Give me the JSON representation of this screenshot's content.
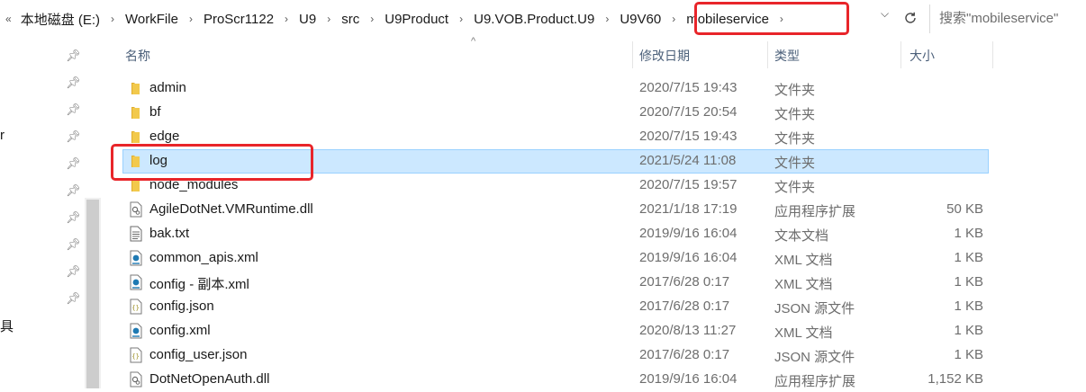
{
  "address": {
    "lead": "«",
    "separator": "›",
    "crumbs": [
      "本地磁盘 (E:)",
      "WorkFile",
      "ProScr1122",
      "U9",
      "src",
      "U9Product",
      "U9.VOB.Product.U9",
      "U9V60",
      "mobileservice"
    ],
    "dropdown_icon": "chevron-down-icon",
    "refresh_icon": "refresh-icon"
  },
  "search": {
    "placeholder": "搜索\"mobileservice\""
  },
  "navpane": {
    "fragments": [
      "r",
      "具"
    ],
    "pin_icon": "pin-icon"
  },
  "columns": {
    "name": "名称",
    "modified": "修改日期",
    "type": "类型",
    "size": "大小"
  },
  "files": [
    {
      "name": "admin",
      "modified": "2020/7/15 19:43",
      "type": "文件夹",
      "size": "",
      "icon": "folder-icon"
    },
    {
      "name": "bf",
      "modified": "2020/7/15 20:54",
      "type": "文件夹",
      "size": "",
      "icon": "folder-icon"
    },
    {
      "name": "edge",
      "modified": "2020/7/15 19:43",
      "type": "文件夹",
      "size": "",
      "icon": "folder-icon"
    },
    {
      "name": "log",
      "modified": "2021/5/24 11:08",
      "type": "文件夹",
      "size": "",
      "icon": "folder-icon",
      "selected": true
    },
    {
      "name": "node_modules",
      "modified": "2020/7/15 19:57",
      "type": "文件夹",
      "size": "",
      "icon": "folder-icon"
    },
    {
      "name": "AgileDotNet.VMRuntime.dll",
      "modified": "2021/1/18 17:19",
      "type": "应用程序扩展",
      "size": "50 KB",
      "icon": "dll-file-icon"
    },
    {
      "name": "bak.txt",
      "modified": "2019/9/16 16:04",
      "type": "文本文档",
      "size": "1 KB",
      "icon": "text-file-icon"
    },
    {
      "name": "common_apis.xml",
      "modified": "2019/9/16 16:04",
      "type": "XML 文档",
      "size": "1 KB",
      "icon": "xml-file-icon"
    },
    {
      "name": "config - 副本.xml",
      "modified": "2017/6/28 0:17",
      "type": "XML 文档",
      "size": "1 KB",
      "icon": "xml-file-icon"
    },
    {
      "name": "config.json",
      "modified": "2017/6/28 0:17",
      "type": "JSON 源文件",
      "size": "1 KB",
      "icon": "json-file-icon"
    },
    {
      "name": "config.xml",
      "modified": "2020/8/13 11:27",
      "type": "XML 文档",
      "size": "1 KB",
      "icon": "xml-file-icon"
    },
    {
      "name": "config_user.json",
      "modified": "2017/6/28 0:17",
      "type": "JSON 源文件",
      "size": "1 KB",
      "icon": "json-file-icon"
    },
    {
      "name": "DotNetOpenAuth.dll",
      "modified": "2019/9/16 16:04",
      "type": "应用程序扩展",
      "size": "1,152 KB",
      "icon": "dll-file-icon"
    }
  ],
  "colors": {
    "selection_fill": "#cce8ff",
    "selection_border": "#99d1ff",
    "highlight_box": "#e8252a",
    "folder": "#f2c94c",
    "header_text": "#4c607a"
  }
}
